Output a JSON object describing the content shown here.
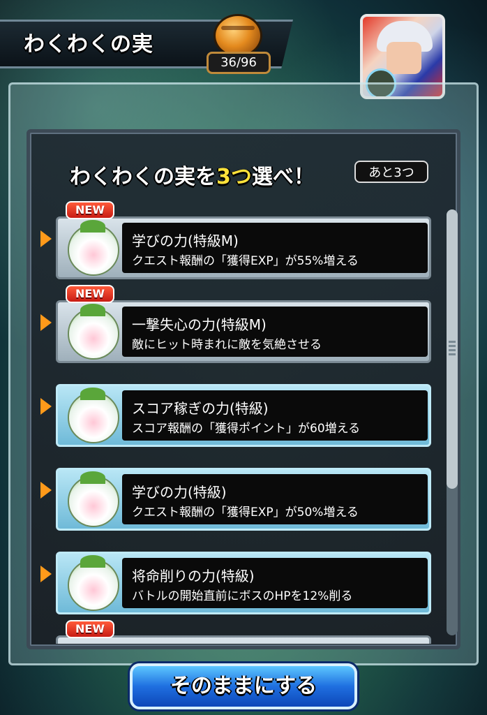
{
  "header": {
    "title": "わくわくの実",
    "fruit_count": "36/96"
  },
  "panel": {
    "heading_prefix": "わくわくの実を",
    "heading_accent": "3つ",
    "heading_suffix": "選べ！",
    "remaining": "あと3つ"
  },
  "items": [
    {
      "new": true,
      "new_label": "NEW",
      "style": "gray",
      "title": "学びの力(特級M)",
      "desc": "クエスト報酬の「獲得EXP」が55%増える"
    },
    {
      "new": true,
      "new_label": "NEW",
      "style": "gray",
      "title": "一撃失心の力(特級M)",
      "desc": "敵にヒット時まれに敵を気絶させる"
    },
    {
      "new": false,
      "new_label": "",
      "style": "blue",
      "title": "スコア稼ぎの力(特級)",
      "desc": "スコア報酬の「獲得ポイント」が60増える"
    },
    {
      "new": false,
      "new_label": "",
      "style": "blue",
      "title": "学びの力(特級)",
      "desc": "クエスト報酬の「獲得EXP」が50%増える"
    },
    {
      "new": false,
      "new_label": "",
      "style": "blue",
      "title": "将命削りの力(特級)",
      "desc": "バトルの開始直前にボスのHPを12%削る"
    },
    {
      "new": true,
      "new_label": "NEW",
      "style": "gray",
      "title": "",
      "desc": ""
    }
  ],
  "footer": {
    "button_label": "そのままにする"
  },
  "colors": {
    "accent_yellow": "#ffe23a",
    "arrow_orange": "#ff9a1a",
    "button_blue": "#1f6fe0"
  }
}
